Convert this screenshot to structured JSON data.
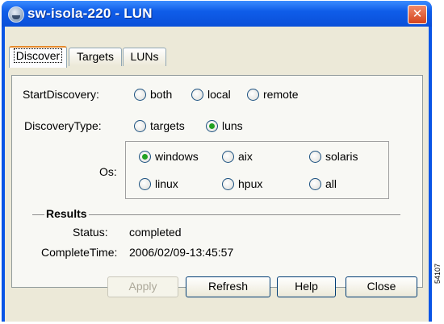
{
  "window": {
    "title": "sw-isola-220 - LUN",
    "close_glyph": "✕"
  },
  "tabs": [
    {
      "label": "Discover",
      "active": true
    },
    {
      "label": "Targets",
      "active": false
    },
    {
      "label": "LUNs",
      "active": false
    }
  ],
  "discover": {
    "start_discovery": {
      "label": "StartDiscovery:",
      "options": [
        {
          "label": "both",
          "checked": false
        },
        {
          "label": "local",
          "checked": false
        },
        {
          "label": "remote",
          "checked": false
        }
      ]
    },
    "discovery_type": {
      "label": "DiscoveryType:",
      "options": [
        {
          "label": "targets",
          "checked": false
        },
        {
          "label": "luns",
          "checked": true
        }
      ]
    },
    "os": {
      "label": "Os:",
      "options": [
        {
          "label": "windows",
          "checked": true
        },
        {
          "label": "aix",
          "checked": false
        },
        {
          "label": "solaris",
          "checked": false
        },
        {
          "label": "linux",
          "checked": false
        },
        {
          "label": "hpux",
          "checked": false
        },
        {
          "label": "all",
          "checked": false
        }
      ]
    }
  },
  "results": {
    "title": "Results",
    "status_label": "Status:",
    "status_value": "completed",
    "complete_time_label": "CompleteTime:",
    "complete_time_value": "2006/02/09-13:45:57"
  },
  "buttons": {
    "apply": "Apply",
    "refresh": "Refresh",
    "help": "Help",
    "close": "Close"
  },
  "figure_id": "54107",
  "colors": {
    "title_bar": "#0a55e6",
    "client_bg": "#ece9d8",
    "radio_checked": "#21a121"
  }
}
